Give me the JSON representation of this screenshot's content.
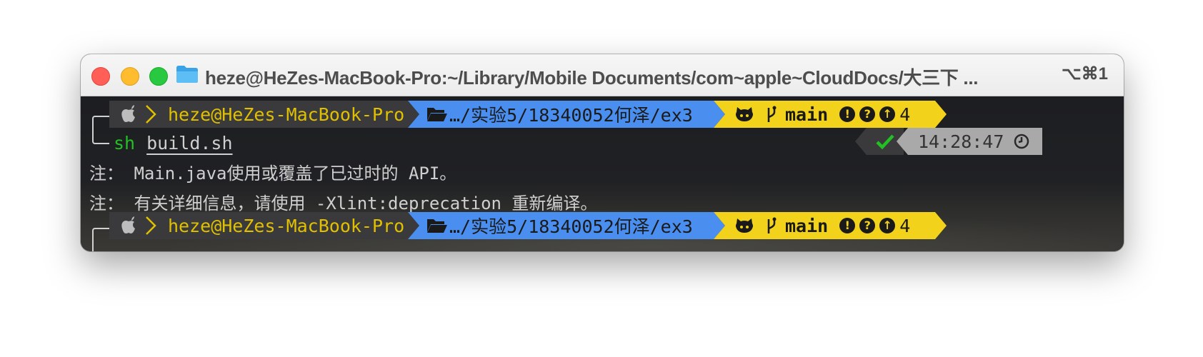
{
  "window": {
    "title": "heze@HeZes-MacBook-Pro:~/Library/Mobile Documents/com~apple~CloudDocs/大三下 ...",
    "shortcut": "⌥⌘1"
  },
  "prompt1": {
    "user_host": "heze@HeZes-MacBook-Pro",
    "dir": "…/实验5/18340052何泽/ex3",
    "branch": "main",
    "status_count": "4"
  },
  "command": {
    "program": "sh",
    "argument": "build.sh"
  },
  "right_prompt": {
    "time": "14:28:47"
  },
  "output": [
    "注： Main.java使用或覆盖了已过时的 API。",
    "注： 有关详细信息，请使用 -Xlint:deprecation 重新编译。"
  ],
  "prompt2": {
    "user_host": "heze@HeZes-MacBook-Pro",
    "dir": "…/实验5/18340052何泽/ex3",
    "branch": "main",
    "status_count": "4"
  },
  "colors": {
    "os_segment": "#3a3a3c",
    "dir_segment": "#4a8ff0",
    "git_segment": "#f2d21b",
    "time_segment": "#a9a9a9",
    "command_green": "#22c022"
  },
  "icons": [
    "apple-icon",
    "folder-icon",
    "github-icon",
    "branch-icon",
    "exclamation-icon",
    "question-icon",
    "arrow-up-icon",
    "check-icon",
    "clock-icon"
  ]
}
